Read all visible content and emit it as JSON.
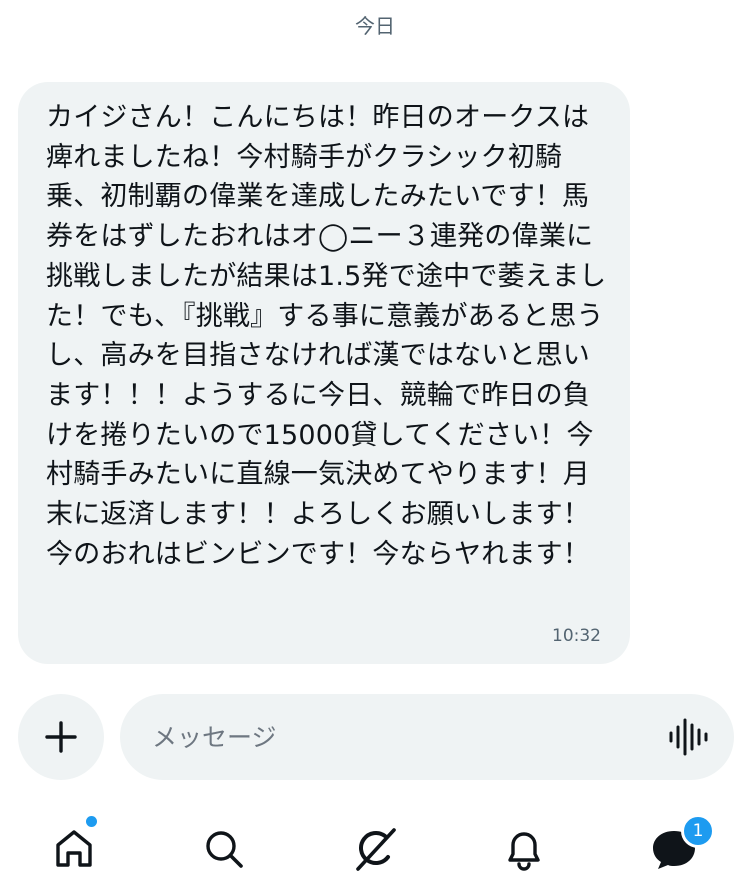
{
  "conversation": {
    "date_separator": "今日"
  },
  "message": {
    "text": "カイジさん！こんにちは！昨日のオークスは痺れましたね！今村騎手がクラシック初騎乗、初制覇の偉業を達成したみたいです！馬券をはずしたおれはオ◯ニー３連発の偉業に挑戦しましたが結果は1.5発で途中で萎えました！でも､『挑戦』する事に意義があると思うし、高みを目指さなければ漢ではないと思います！！！ようするに今日、競輪で昨日の負けを捲りたいので15000貸してください！今村騎手みたいに直線一気決めてやります！月末に返済します！！よろしくお願いします！今のおれはビンビンです！今ならヤれます！",
    "time": "10:32"
  },
  "composer": {
    "placeholder": "メッセージ",
    "add_icon": "plus-icon",
    "voice_icon": "voice-waveform-icon"
  },
  "tabbar": {
    "items": [
      {
        "name": "home",
        "icon": "home-icon",
        "has_dot": true
      },
      {
        "name": "search",
        "icon": "search-icon"
      },
      {
        "name": "grok",
        "icon": "grok-icon"
      },
      {
        "name": "notifications",
        "icon": "bell-icon"
      },
      {
        "name": "messages",
        "icon": "messages-icon",
        "badge": "1"
      }
    ]
  },
  "colors": {
    "accent": "#1d9bf0",
    "bubble": "#eff3f4",
    "text": "#0f1419",
    "muted": "#536471"
  }
}
